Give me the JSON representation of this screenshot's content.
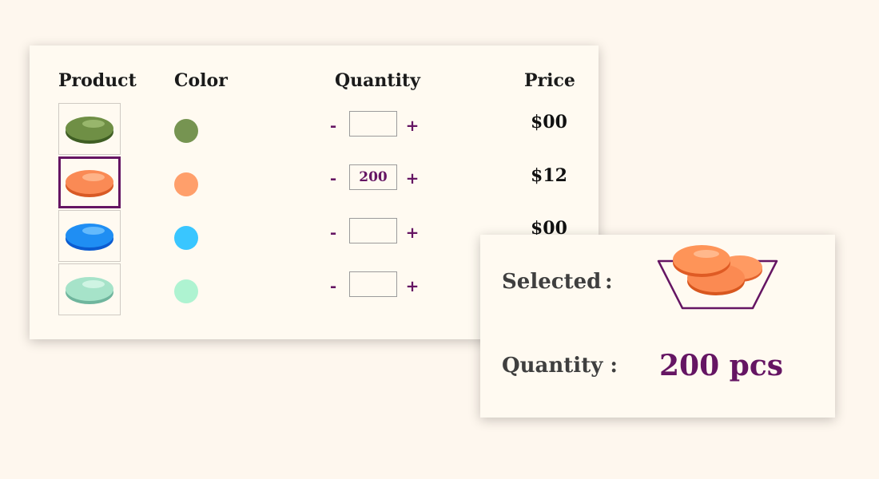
{
  "table": {
    "headers": {
      "product": "Product",
      "color": "Color",
      "quantity": "Quantity",
      "price": "Price"
    },
    "rows": [
      {
        "product_icon": "green-pill-icon",
        "color": "#769451",
        "quantity": "",
        "price": "$00",
        "selected": false
      },
      {
        "product_icon": "orange-pill-icon",
        "color": "#ff9f6b",
        "quantity": "200",
        "price": "$12",
        "selected": true
      },
      {
        "product_icon": "blue-pill-icon",
        "color": "#39c6ff",
        "quantity": "",
        "price": "$00",
        "selected": false
      },
      {
        "product_icon": "mint-pill-icon",
        "color": "#aef3d1",
        "quantity": "",
        "price": "",
        "selected": false
      }
    ],
    "minus_label": "-",
    "plus_label": "+"
  },
  "summary": {
    "selected_label": "Selected",
    "selected_colon": ":",
    "selected_icon": "basket-with-orange-pills-icon",
    "quantity_label": "Quantity :",
    "quantity_value": "200 pcs"
  },
  "colors": {
    "accent": "#651563",
    "background": "#fef7ee",
    "card": "#fffaf1"
  }
}
